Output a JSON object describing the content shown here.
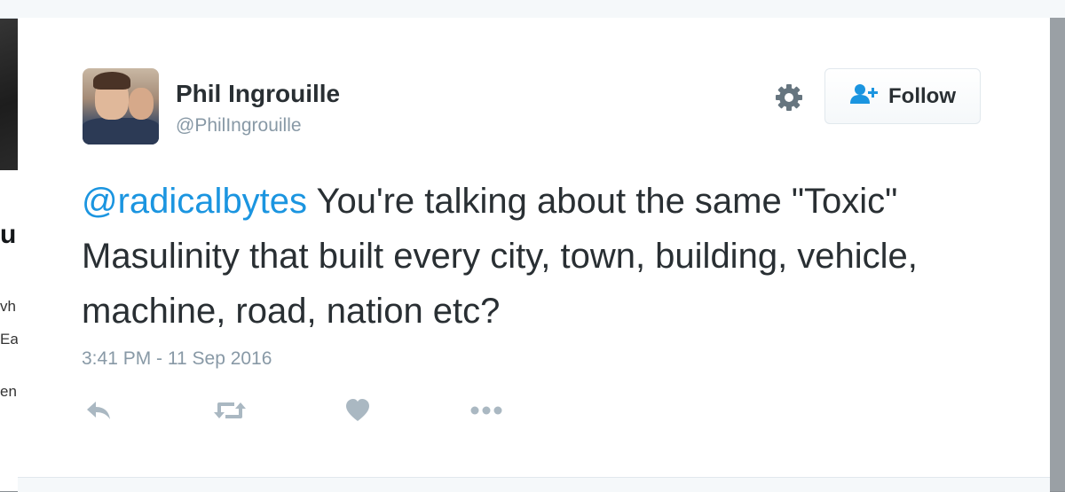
{
  "tweet": {
    "author_name": "Phil Ingrouille",
    "author_handle": "@PhilIngrouille",
    "mention": "@radicalbytes",
    "text": " You're talking about the same \"Toxic\" Masulinity that built every city, town, building, vehicle, machine, road, nation etc?",
    "timestamp": "3:41 PM - 11 Sep 2016"
  },
  "header": {
    "follow_label": "Follow",
    "settings_icon": "gear-icon",
    "follow_icon": "add-user-icon"
  },
  "actions": [
    {
      "name": "reply",
      "icon": "reply-icon"
    },
    {
      "name": "retweet",
      "icon": "retweet-icon"
    },
    {
      "name": "like",
      "icon": "heart-icon"
    },
    {
      "name": "more",
      "icon": "more-icon"
    }
  ],
  "background_page": {
    "heading_fragment": "u",
    "line_fragments": [
      "vh",
      "Ea",
      "en"
    ]
  },
  "colors": {
    "text": "#292f33",
    "muted": "#8899a6",
    "link": "#1b95e0",
    "icon": "#aab8c2",
    "gear": "#66757f"
  }
}
